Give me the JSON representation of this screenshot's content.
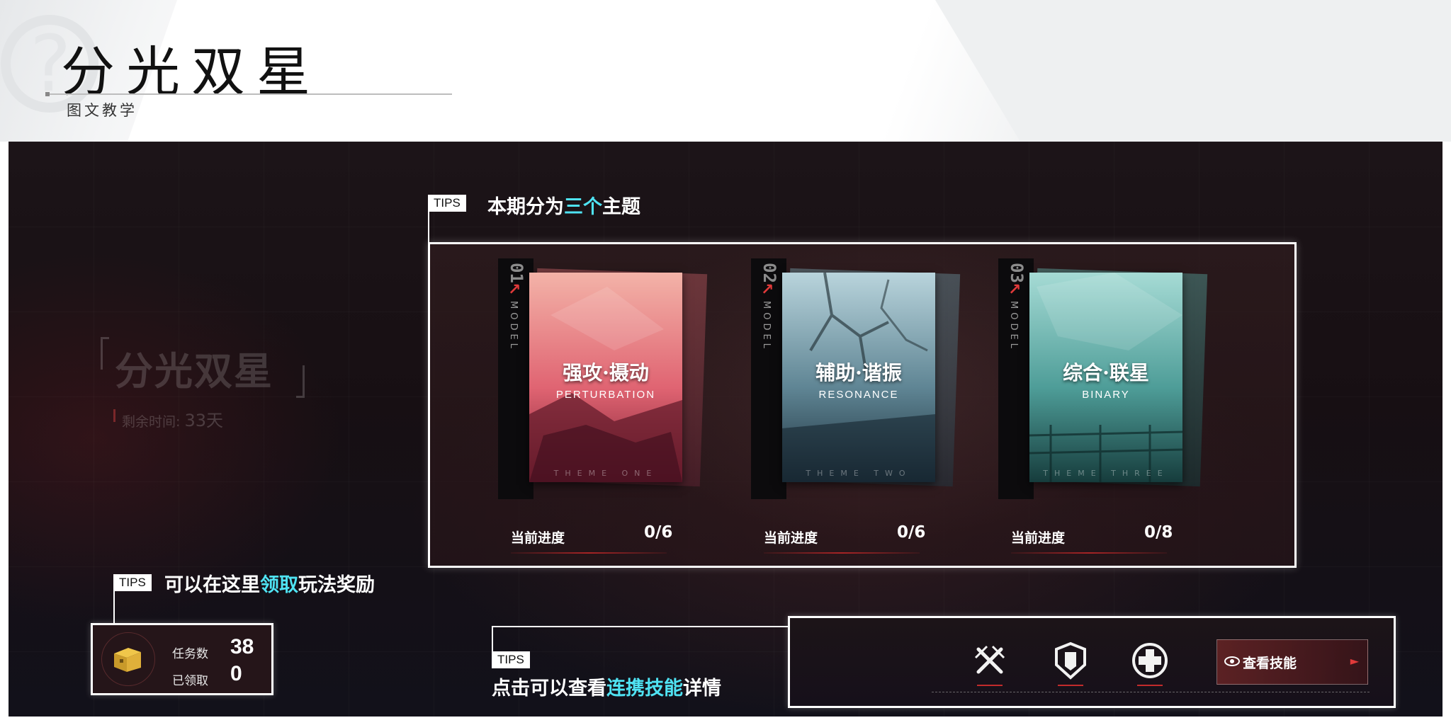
{
  "header": {
    "title": "分光双星",
    "subtitle": "图文教学"
  },
  "event_panel": {
    "title": "分光双星",
    "remaining_label": "剩余时间:",
    "remaining_value": "33天"
  },
  "tips_badge": "TIPS",
  "tip_themes": {
    "before": "本期分为",
    "highlight": "三个",
    "after": "主题"
  },
  "themes": [
    {
      "number": "01",
      "model_label": "MODEL",
      "name": "强攻·摄动",
      "english": "PERTURBATION",
      "footer": "THEME ONE",
      "progress_label": "当前进度",
      "progress": "0/6",
      "palette": [
        "#f3b3a8",
        "#e06472",
        "#7c1f33"
      ]
    },
    {
      "number": "02",
      "model_label": "MODEL",
      "name": "辅助·谐振",
      "english": "RESONANCE",
      "footer": "THEME TWO",
      "progress_label": "当前进度",
      "progress": "0/6",
      "palette": [
        "#b9d4dc",
        "#5f8594",
        "#1c2e3a"
      ]
    },
    {
      "number": "03",
      "model_label": "MODEL",
      "name": "综合·联星",
      "english": "BINARY",
      "footer": "THEME THREE",
      "progress_label": "当前进度",
      "progress": "0/8",
      "palette": [
        "#a6dbd5",
        "#4e9d98",
        "#163c3c"
      ]
    }
  ],
  "tip_rewards": {
    "before": "可以在这里",
    "highlight": "领取",
    "after": "玩法奖励"
  },
  "rewards": {
    "tasks_label": "任务数",
    "tasks_value": "38",
    "claimed_label": "已领取",
    "claimed_value": "0"
  },
  "tip_skills": {
    "before": "点击可以查看",
    "highlight": "连携技能",
    "after": "详情"
  },
  "skills": {
    "icons": [
      "crossed-swords-icon",
      "shield-icon",
      "medical-cross-icon"
    ],
    "view_button": "查看技能"
  },
  "colors": {
    "highlight": "#4fe3f3",
    "accent_red": "#e13a3a"
  }
}
